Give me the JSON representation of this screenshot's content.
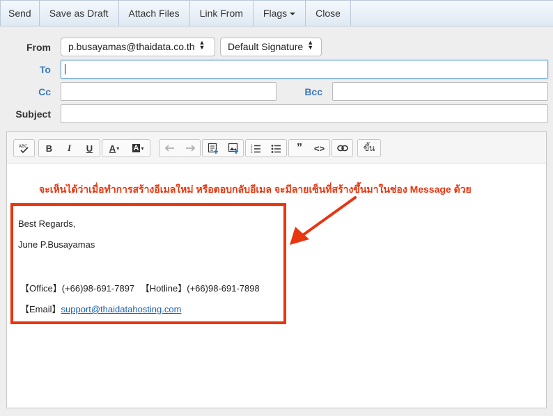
{
  "toolbar": {
    "send": "Send",
    "save_draft": "Save as Draft",
    "attach": "Attach Files",
    "link_from": "Link From",
    "flags": "Flags",
    "close": "Close"
  },
  "form": {
    "from_label": "From",
    "from_value": "p.busayamas@thaidata.co.th",
    "signature_value": "Default Signature",
    "to_label": "To",
    "to_value": "",
    "cc_label": "Cc",
    "cc_value": "",
    "bcc_label": "Bcc",
    "bcc_value": "",
    "subject_label": "Subject",
    "subject_value": ""
  },
  "editor": {
    "tools": [
      "spellcheck-icon",
      "bold-icon",
      "italic-icon",
      "underline-icon",
      "font-color-icon",
      "background-color-icon",
      "undo-icon",
      "redo-icon",
      "insert-template-icon",
      "insert-image-icon",
      "numbered-list-icon",
      "bulleted-list-icon",
      "blockquote-icon",
      "code-icon",
      "link-icon"
    ],
    "labels": {
      "bold": "B",
      "italic": "I",
      "underline": "U",
      "font_color": "A",
      "background_color": "A",
      "blockquote": "99",
      "code": "<>",
      "thai_button": "ขึ้น"
    }
  },
  "annotation": {
    "text": "จะเห็นได้ว่าเมื่อทำการสร้างอีเมลใหม่ หรือตอบกลับอีเมล จะมีลายเซ็นที่สร้างขึ้นมาในช่อง Message ด้วย",
    "color": "#e8360f"
  },
  "signature": {
    "line1": "Best Regards,",
    "line2": "June P.Busayamas",
    "office": "【Office】(+66)98-691-7897",
    "hotline": "【Hotline】(+66)98-691-7898",
    "email_label": "【Email】",
    "email_link": "support@thaidatahosting.com"
  },
  "colors": {
    "accent_label": "#3b7bbf",
    "highlight": "#e8360f",
    "link": "#1a5fb4"
  }
}
